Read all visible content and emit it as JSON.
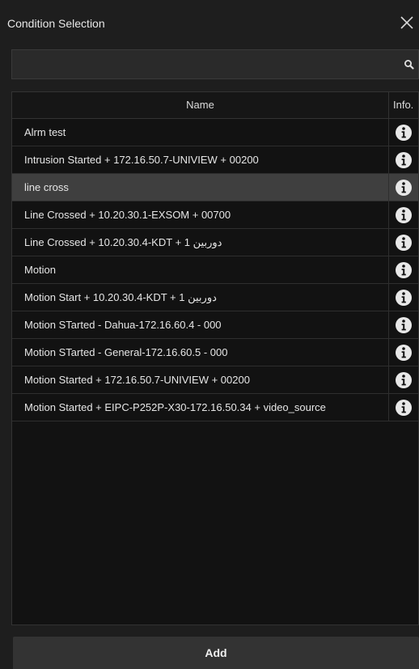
{
  "window": {
    "title": "Condition Selection"
  },
  "search": {
    "placeholder": "",
    "value": ""
  },
  "table": {
    "columns": {
      "name": "Name",
      "info": "Info."
    },
    "selected_index": 2,
    "rows": [
      "Alrm test",
      "Intrusion Started + 172.16.50.7-UNIVIEW + 00200",
      "line cross",
      "Line Crossed + 10.20.30.1-EXSOM + 00700",
      "Line Crossed + 10.20.30.4-KDT + دوربین 1",
      "Motion",
      "Motion Start + 10.20.30.4-KDT + دوربین 1",
      "Motion STarted - Dahua-172.16.60.4 - 000",
      "Motion STarted - General-172.16.60.5 - 000",
      "Motion Started + 172.16.50.7-UNIVIEW + 00200",
      "Motion Started + EIPC-P252P-X30-172.16.50.34 + video_source"
    ]
  },
  "footer": {
    "add_label": "Add"
  },
  "colors": {
    "background": "#1e1e1e",
    "table_background": "#121212",
    "selected_row": "#3f3f3f",
    "button": "#333333"
  },
  "icons": {
    "close": "close-icon",
    "search": "search-icon",
    "info": "info-icon"
  }
}
